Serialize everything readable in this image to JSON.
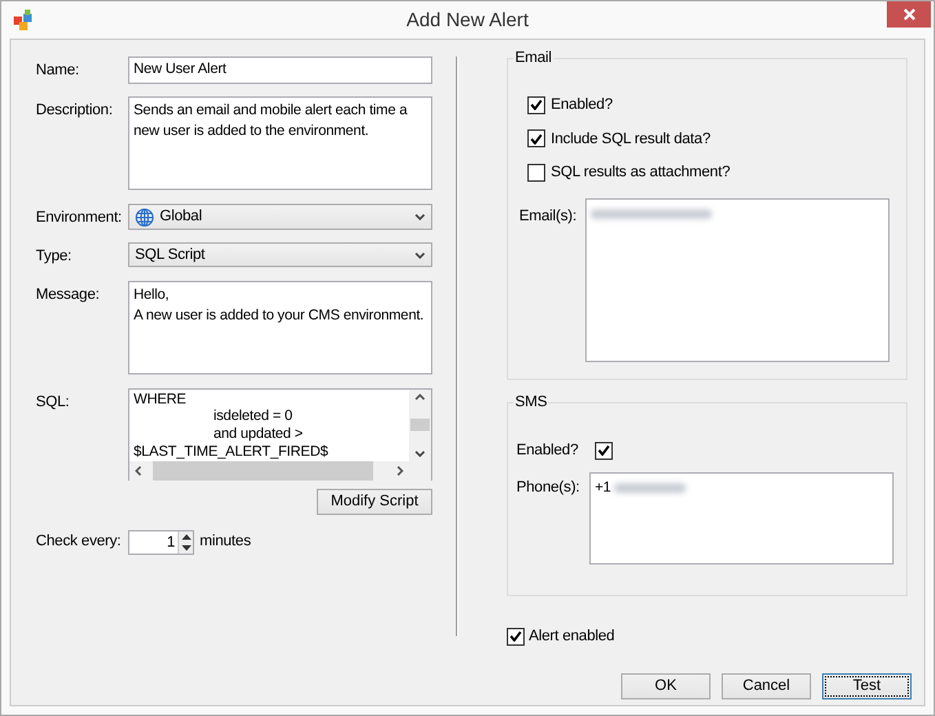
{
  "window": {
    "title": "Add New Alert"
  },
  "form": {
    "name": {
      "label": "Name:",
      "value": "New User Alert"
    },
    "description": {
      "label": "Description:",
      "value": "Sends an email and mobile alert each time a new user is added to the environment."
    },
    "environment": {
      "label": "Environment:",
      "value": "Global"
    },
    "type": {
      "label": "Type:",
      "value": "SQL Script"
    },
    "message": {
      "label": "Message:",
      "lines": [
        "Hello,",
        "A new user is added to your CMS environment."
      ]
    },
    "sql": {
      "label": "SQL:",
      "lines": [
        {
          "text": "WHERE",
          "indented": false
        },
        {
          "text": "isdeleted = 0",
          "indented": true
        },
        {
          "text": "and updated >",
          "indented": true
        },
        {
          "text": "$LAST_TIME_ALERT_FIRED$",
          "indented": false
        }
      ]
    },
    "modify_button": "Modify Script",
    "check_every": {
      "label": "Check every:",
      "value": "1",
      "unit": "minutes"
    }
  },
  "email": {
    "title": "Email",
    "options": [
      {
        "label": "Enabled?",
        "checked": true
      },
      {
        "label": "Include SQL result data?",
        "checked": true
      },
      {
        "label": "SQL results as attachment?",
        "checked": false
      }
    ],
    "emails_label": "Email(s):"
  },
  "sms": {
    "title": "SMS",
    "enabled": {
      "label": "Enabled?",
      "checked": true
    },
    "phones_label": "Phone(s):",
    "phone_prefix": "+1"
  },
  "alert_enabled": {
    "label": "Alert enabled",
    "checked": true
  },
  "buttons": [
    {
      "label": "OK",
      "focused": false
    },
    {
      "label": "Cancel",
      "focused": false
    },
    {
      "label": "Test",
      "focused": true
    }
  ]
}
